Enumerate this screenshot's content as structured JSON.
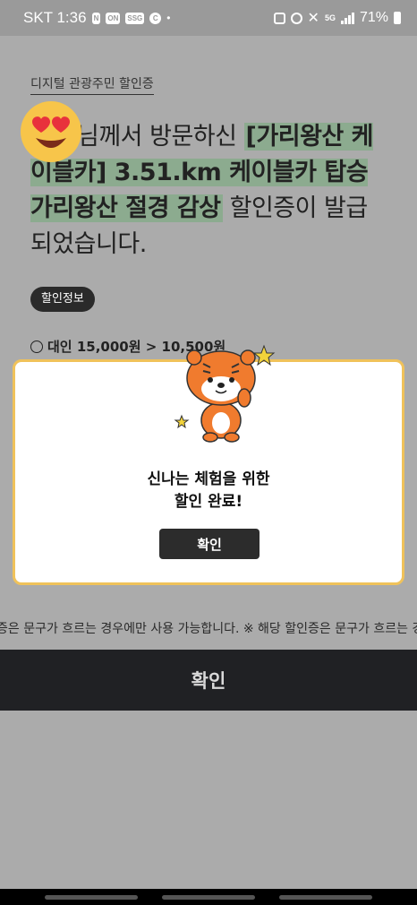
{
  "status_bar": {
    "carrier_time": "SKT 1:36",
    "badges": [
      "N",
      "ON",
      "SSG",
      "C"
    ],
    "network": "5G",
    "battery": "71%"
  },
  "page": {
    "breadcrumb": "디지털 관광주민 할인증",
    "headline_prefix": "님께서 방문하신 ",
    "headline_highlight_1": "[가리왕산 케이블카] 3.51.km 케이블카 탑승 가리왕산 절경 감상",
    "headline_suffix": " 할인증이 발급되었습니다.",
    "tag_label": "할인정보",
    "price_line": "대인 15,000원 > 10,500원"
  },
  "modal": {
    "title_line1": "신나는 체험을 위한",
    "title_line2": "할인 완료!",
    "confirm_label": "확인"
  },
  "marquee_text": "증은 문구가 흐르는 경우에만 사용 가능합니다. ※ 해당 할인증은 문구가 흐르는 경",
  "bottom_button_label": "확인",
  "colors": {
    "overlay": "#ababab",
    "highlight": "#8cab8f",
    "modal_border": "#f0c25a",
    "dark_button": "#202124"
  }
}
